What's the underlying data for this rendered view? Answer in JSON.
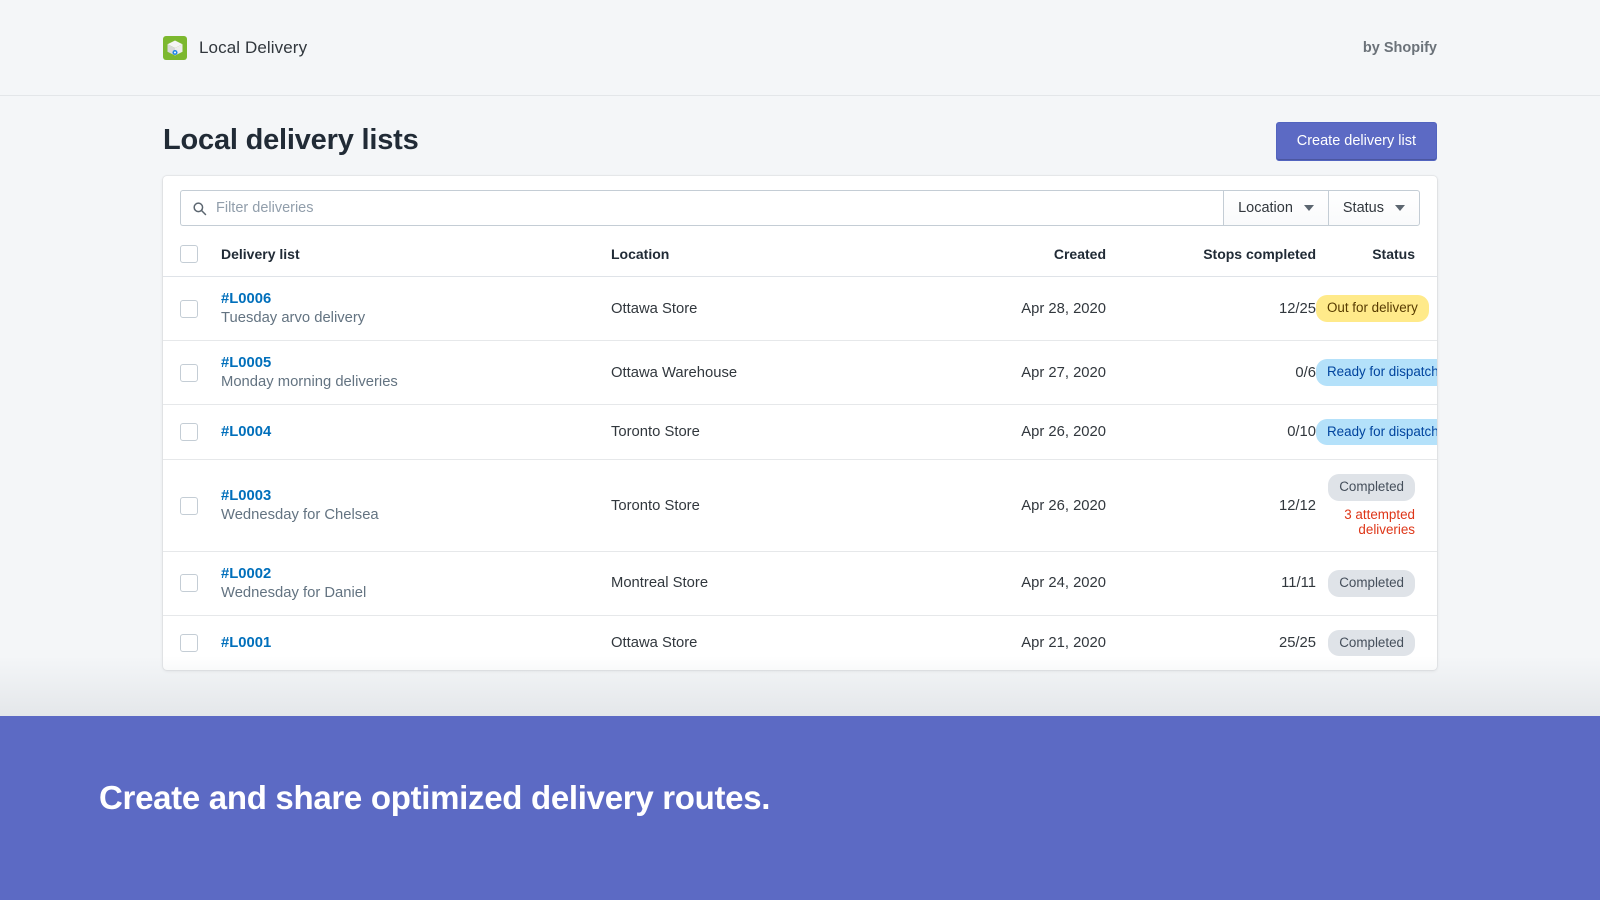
{
  "topbar": {
    "app_icon": "package-box-icon",
    "brand_name": "Local Delivery",
    "byline": "by Shopify"
  },
  "header": {
    "title": "Local delivery lists",
    "create_button": "Create delivery list"
  },
  "filters": {
    "search_placeholder": "Filter deliveries",
    "search_value": "",
    "search_icon": "search-icon",
    "location_label": "Location",
    "status_label": "Status"
  },
  "table": {
    "columns": [
      "Delivery list",
      "Location",
      "Created",
      "Stops completed",
      "Status"
    ],
    "rows": [
      {
        "id": "#L0006",
        "subtitle": "Tuesday arvo delivery",
        "location": "Ottawa Store",
        "created": "Apr 28, 2020",
        "stops": "12/25",
        "status": "Out for delivery",
        "status_tone": "yellow",
        "note": ""
      },
      {
        "id": "#L0005",
        "subtitle": "Monday morning deliveries",
        "location": "Ottawa Warehouse",
        "created": "Apr 27, 2020",
        "stops": "0/6",
        "status": "Ready for dispatch",
        "status_tone": "blue",
        "note": ""
      },
      {
        "id": "#L0004",
        "subtitle": "",
        "location": "Toronto Store",
        "created": "Apr 26, 2020",
        "stops": "0/10",
        "status": "Ready for dispatch",
        "status_tone": "blue",
        "note": ""
      },
      {
        "id": "#L0003",
        "subtitle": "Wednesday for Chelsea",
        "location": "Toronto Store",
        "created": "Apr 26, 2020",
        "stops": "12/12",
        "status": "Completed",
        "status_tone": "grey",
        "note": "3 attempted deliveries"
      },
      {
        "id": "#L0002",
        "subtitle": "Wednesday for Daniel",
        "location": "Montreal Store",
        "created": "Apr 24, 2020",
        "stops": "11/11",
        "status": "Completed",
        "status_tone": "grey",
        "note": ""
      },
      {
        "id": "#L0001",
        "subtitle": "",
        "location": "Ottawa Store",
        "created": "Apr 21, 2020",
        "stops": "25/25",
        "status": "Completed",
        "status_tone": "grey",
        "note": ""
      }
    ]
  },
  "banner": {
    "headline": "Create and share optimized delivery routes."
  },
  "colors": {
    "accent": "#5c6ac4",
    "link": "#006fbb",
    "badge_yellow": "#ffea8a",
    "badge_blue": "#b4e1fa",
    "badge_grey": "#dfe3e8",
    "critical_text": "#de3618",
    "app_icon_green": "#7cb82f",
    "page_background": "#f4f6f8"
  }
}
